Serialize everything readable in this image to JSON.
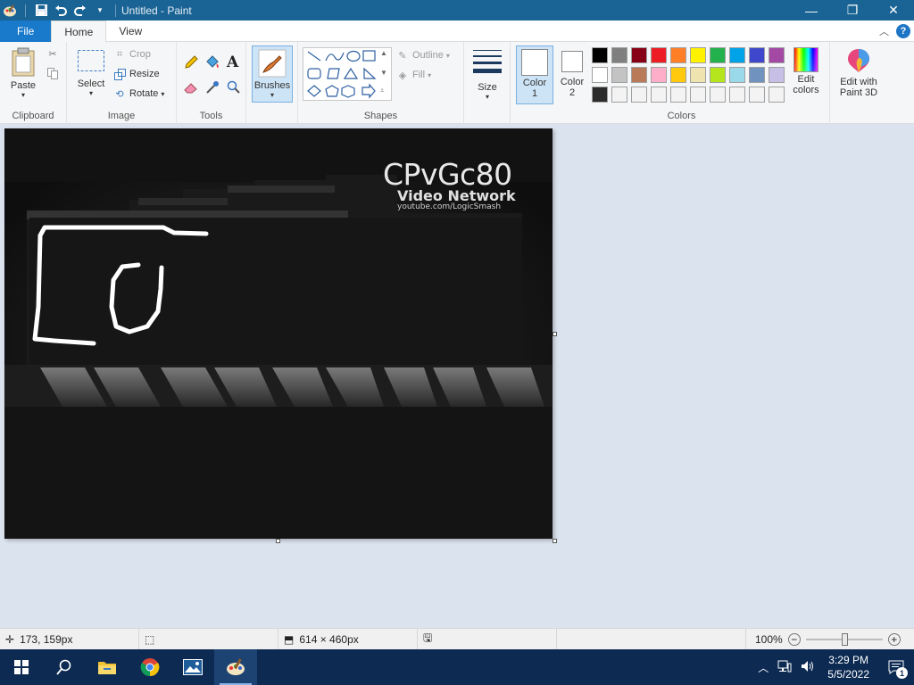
{
  "titlebar": {
    "title": "Untitled - Paint",
    "minimize": "—",
    "maximize": "❐",
    "close": "✕"
  },
  "tabs": {
    "file": "File",
    "home": "Home",
    "view": "View"
  },
  "ribbon": {
    "clipboard": {
      "label": "Clipboard",
      "paste": "Paste"
    },
    "image": {
      "label": "Image",
      "select": "Select",
      "crop": "Crop",
      "resize": "Resize",
      "rotate": "Rotate"
    },
    "tools": {
      "label": "Tools"
    },
    "brushes": {
      "label": "Brushes"
    },
    "shapes": {
      "label": "Shapes",
      "outline": "Outline",
      "fill": "Fill"
    },
    "size": {
      "label": "Size"
    },
    "colors": {
      "label": "Colors",
      "color1": "Color",
      "color1_num": "1",
      "color2": "Color",
      "color2_num": "2",
      "edit_colors_1": "Edit",
      "edit_colors_2": "colors",
      "paint3d_1": "Edit with",
      "paint3d_2": "Paint 3D",
      "palette_row1": [
        "#000000",
        "#7f7f7f",
        "#880015",
        "#ed1c24",
        "#ff7f27",
        "#fff200",
        "#22b14c",
        "#00a2e8",
        "#3f48cc",
        "#a349a4"
      ],
      "palette_row2": [
        "#ffffff",
        "#c3c3c3",
        "#b97a57",
        "#ffaec9",
        "#ffc90e",
        "#efe4b0",
        "#b5e61d",
        "#99d9ea",
        "#7092be",
        "#c8bfe7"
      ],
      "palette_row3": [
        "#2b2b2b",
        "#f3f3f3",
        "#f3f3f3",
        "#f3f3f3",
        "#f3f3f3",
        "#f3f3f3",
        "#f3f3f3",
        "#f3f3f3",
        "#f3f3f3",
        "#f3f3f3"
      ]
    }
  },
  "canvas": {
    "logo_main": "CPvGc80",
    "logo_sub": "Video Network",
    "logo_url": "youtube.com/LogicSmash"
  },
  "statusbar": {
    "cursor_pos": "173, 159px",
    "image_size": "614 × 460px",
    "zoom": "100%"
  },
  "taskbar": {
    "time": "3:29 PM",
    "date": "5/5/2022",
    "notifications": "1"
  }
}
